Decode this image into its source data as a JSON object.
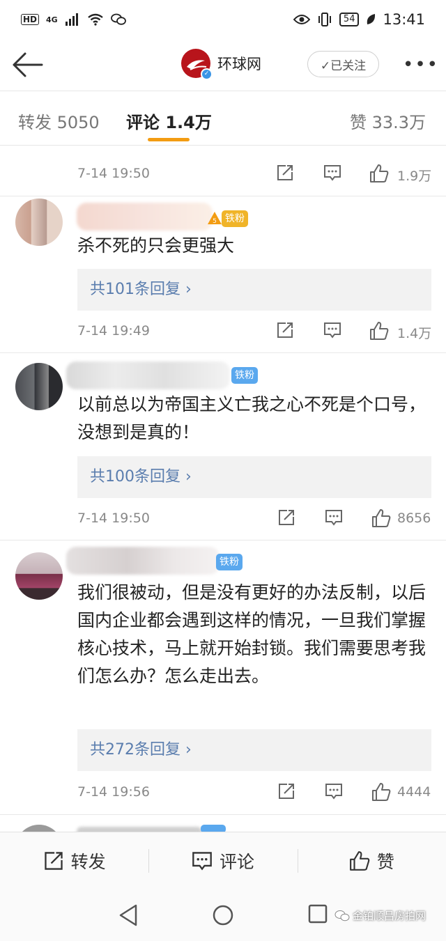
{
  "status_bar": {
    "hd": "HD",
    "network": "4G",
    "battery": "54",
    "time": "13:41"
  },
  "nav": {
    "account_name": "环球网",
    "follow_label": "✓已关注",
    "more_label": "•••"
  },
  "tabs": [
    {
      "label": "转发 5050",
      "active": false
    },
    {
      "label": "评论 1.4万",
      "active": true
    },
    {
      "label": "赞 33.3万",
      "active": false
    }
  ],
  "prev_comment": {
    "time": "7-14 19:50",
    "likes": "1.9万"
  },
  "comments": [
    {
      "badge": "铁粉",
      "text": "杀不死的只会更强大",
      "replies": "共101条回复 ›",
      "time": "7-14 19:49",
      "likes": "1.4万"
    },
    {
      "badge": "铁粉",
      "text": "以前总以为帝国主义亡我之心不死是个口号，没想到是真的！",
      "replies": "共100条回复 ›",
      "time": "7-14 19:50",
      "likes": "8656"
    },
    {
      "badge": "铁粉",
      "text": "我们很被动，但是没有更好的办法反制，以后国内企业都会遇到这样的情况，一旦我们掌握核心技术，马上就开始封锁。我们需要思考我们怎么办？怎么走出去。",
      "replies": "共272条回复 ›",
      "time": "7-14 19:56",
      "likes": "4444"
    }
  ],
  "bottom_bar": {
    "repost": "转发",
    "comment": "评论",
    "like": "赞"
  },
  "watermark": "金铂顺昌房拍网",
  "colors": {
    "accent_tab_underline": "#f39c12",
    "reply_link": "#5a7dae",
    "badge_blue": "#5aa8ee",
    "badge_gold": "#f0b429",
    "logo_red": "#b8141b"
  },
  "icons": [
    "back-arrow-icon",
    "verified-icon",
    "repost-icon",
    "comment-icon",
    "like-icon",
    "nav-back-icon",
    "nav-home-icon",
    "nav-recents-icon",
    "wechat-icon"
  ]
}
